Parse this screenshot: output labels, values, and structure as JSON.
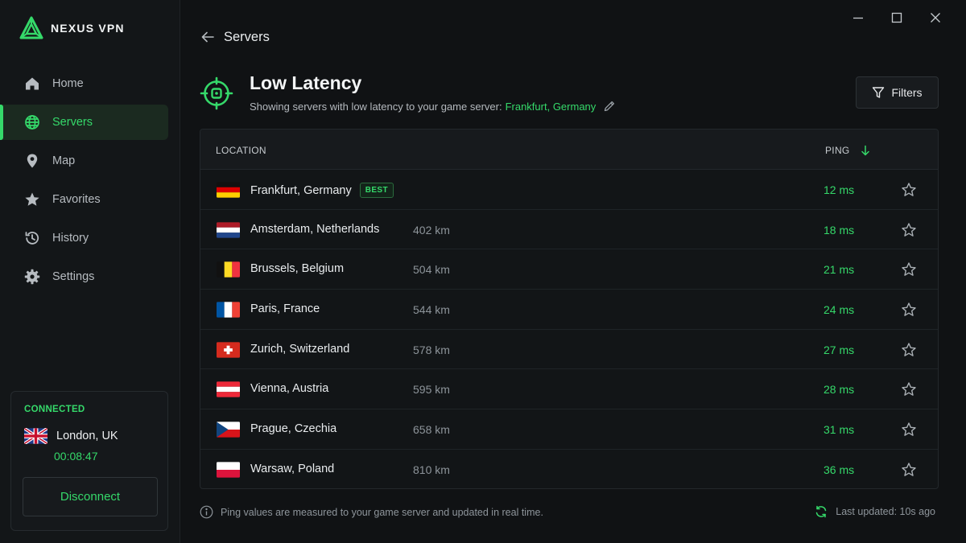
{
  "app": {
    "name": "NEXUS VPN",
    "accent": "#35d96a"
  },
  "sidebar": {
    "items": [
      {
        "label": "Home",
        "icon": "home-icon",
        "active": false
      },
      {
        "label": "Servers",
        "icon": "globe-icon",
        "active": true
      },
      {
        "label": "Map",
        "icon": "map-pin-icon",
        "active": false
      },
      {
        "label": "Favorites",
        "icon": "star-icon",
        "active": false
      },
      {
        "label": "History",
        "icon": "history-icon",
        "active": false
      },
      {
        "label": "Settings",
        "icon": "gear-icon",
        "active": false
      }
    ],
    "connection": {
      "status": "CONNECTED",
      "location": "London, UK",
      "flag": "uk",
      "duration": "00:08:47",
      "disconnect_label": "Disconnect"
    }
  },
  "breadcrumb": {
    "label": "Servers"
  },
  "header": {
    "title": "Low Latency",
    "subtitle_prefix": "Showing servers with low latency to your game server:",
    "game_server": "Frankfurt, Germany",
    "filters_label": "Filters"
  },
  "table": {
    "col_location": "LOCATION",
    "col_ping": "PING",
    "sort": "ping-ascending",
    "rows": [
      {
        "city": "Frankfurt, Germany",
        "flag": "de",
        "distance": "",
        "badge": "BEST",
        "ping": "12 ms"
      },
      {
        "city": "Amsterdam, Netherlands",
        "flag": "nl",
        "distance": "402 km",
        "badge": "",
        "ping": "18 ms"
      },
      {
        "city": "Brussels, Belgium",
        "flag": "be",
        "distance": "504 km",
        "badge": "",
        "ping": "21 ms"
      },
      {
        "city": "Paris, France",
        "flag": "fr",
        "distance": "544 km",
        "badge": "",
        "ping": "24 ms"
      },
      {
        "city": "Zurich, Switzerland",
        "flag": "ch",
        "distance": "578 km",
        "badge": "",
        "ping": "27 ms"
      },
      {
        "city": "Vienna, Austria",
        "flag": "at",
        "distance": "595 km",
        "badge": "",
        "ping": "28 ms"
      },
      {
        "city": "Prague, Czechia",
        "flag": "cz",
        "distance": "658 km",
        "badge": "",
        "ping": "31 ms"
      },
      {
        "city": "Warsaw, Poland",
        "flag": "pl",
        "distance": "810 km",
        "badge": "",
        "ping": "36 ms"
      }
    ]
  },
  "footer": {
    "note": "Ping values are measured to your game server and updated in real time.",
    "updated": "Last updated: 10s ago"
  }
}
